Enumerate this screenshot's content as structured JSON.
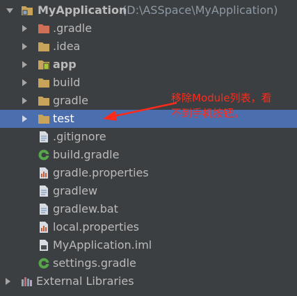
{
  "project": {
    "name": "MyApplication",
    "path": "(D:\\ASSpace\\MyApplication)"
  },
  "items": [
    {
      "label": ".gradle",
      "icon": "folder-excluded-icon"
    },
    {
      "label": ".idea",
      "icon": "folder-icon"
    },
    {
      "label": "app",
      "icon": "android-module-folder-icon"
    },
    {
      "label": "build",
      "icon": "folder-icon"
    },
    {
      "label": "gradle",
      "icon": "folder-icon"
    },
    {
      "label": "test",
      "icon": "folder-icon"
    },
    {
      "label": ".gitignore",
      "icon": "file-icon"
    },
    {
      "label": "build.gradle",
      "icon": "gradle-icon"
    },
    {
      "label": "gradle.properties",
      "icon": "properties-file-icon"
    },
    {
      "label": "gradlew",
      "icon": "file-icon"
    },
    {
      "label": "gradlew.bat",
      "icon": "file-icon"
    },
    {
      "label": "local.properties",
      "icon": "properties-file-icon"
    },
    {
      "label": "MyApplication.iml",
      "icon": "iml-file-icon"
    },
    {
      "label": "settings.gradle",
      "icon": "gradle-icon"
    }
  ],
  "external": {
    "label": "External Libraries",
    "icon": "libraries-icon"
  },
  "annotation": {
    "line1": "移除Module列表，看",
    "line2": "不到手机按钮。"
  },
  "colors": {
    "background": "#3c3f41",
    "selection": "#4b6eaf",
    "annotation": "#ff2a1a",
    "folder": "#c8a35a",
    "excluded": "#d06f58"
  }
}
